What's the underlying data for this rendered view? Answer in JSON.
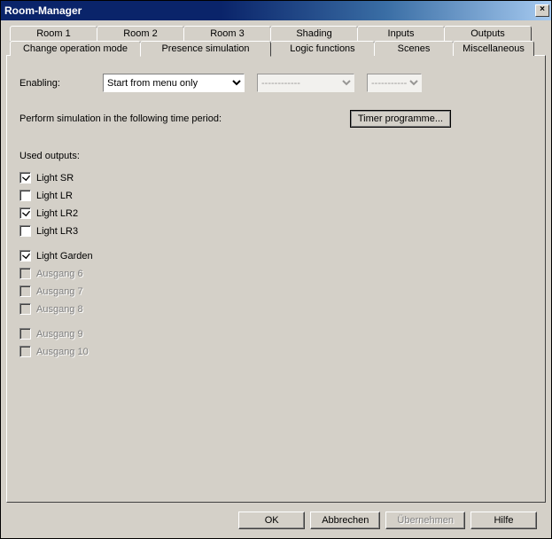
{
  "window": {
    "title": "Room-Manager"
  },
  "tabs_row1": [
    "Room 1",
    "Room 2",
    "Room 3",
    "Shading",
    "Inputs",
    "Outputs"
  ],
  "tabs_row2": [
    "Change operation mode",
    "Presence simulation",
    "Logic functions",
    "Scenes",
    "Miscellaneous"
  ],
  "active_tab": "Presence simulation",
  "enabling": {
    "label": "Enabling:",
    "select1": "Start from menu only",
    "select2": "------------",
    "select3": "------------"
  },
  "time_period_label": "Perform simulation in the following time period:",
  "timer_button": "Timer programme...",
  "used_outputs_label": "Used outputs:",
  "outputs": [
    {
      "label": "Light SR",
      "checked": true,
      "disabled": false
    },
    {
      "label": "Light LR",
      "checked": false,
      "disabled": false
    },
    {
      "label": "Light LR2",
      "checked": true,
      "disabled": false
    },
    {
      "label": "Light LR3",
      "checked": false,
      "disabled": false
    },
    {
      "label": "Light Garden",
      "checked": true,
      "disabled": false
    },
    {
      "label": "Ausgang 6",
      "checked": false,
      "disabled": true
    },
    {
      "label": "Ausgang 7",
      "checked": false,
      "disabled": true
    },
    {
      "label": "Ausgang 8",
      "checked": false,
      "disabled": true
    },
    {
      "label": "Ausgang 9",
      "checked": false,
      "disabled": true
    },
    {
      "label": "Ausgang 10",
      "checked": false,
      "disabled": true
    }
  ],
  "buttons": {
    "ok": "OK",
    "cancel": "Abbrechen",
    "apply": "Übernehmen",
    "help": "Hilfe"
  }
}
